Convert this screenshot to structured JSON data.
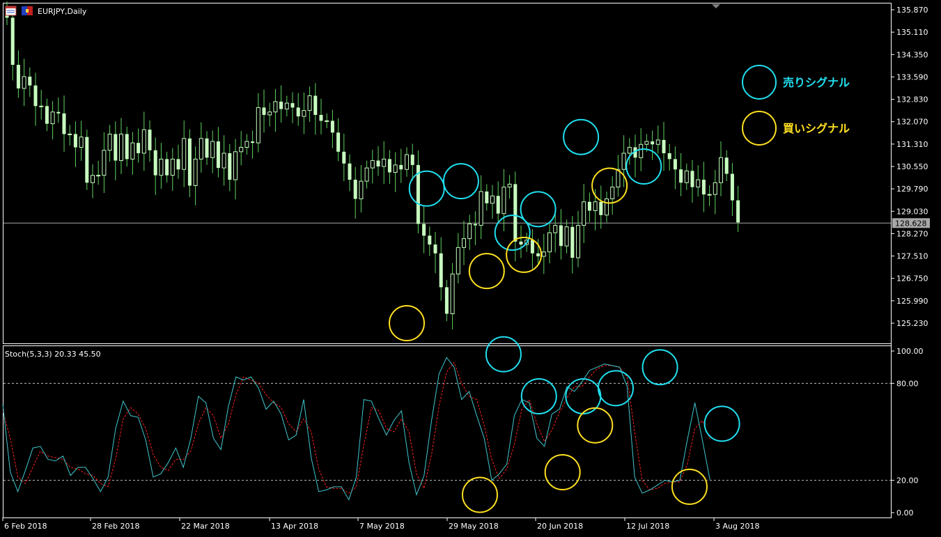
{
  "window": {
    "title": "EURJPY,Daily",
    "icons": [
      "window-menu-icon",
      "flag-icon"
    ]
  },
  "colors": {
    "background": "#000000",
    "axis": "#ffffff",
    "bull_candle": "#c8ffc0",
    "bear_candle": "#c8ffc0",
    "wick": "#5fd35f",
    "price_line": "#a8a8a8",
    "price_tag_bg": "#a8a8a8",
    "stoch_main": "#40c8d0",
    "stoch_signal": "#ff2020",
    "level_line": "#c0c0c0",
    "sell_circle": "#20e0f0",
    "buy_circle": "#ffe020"
  },
  "legend": {
    "sell_label": "売りシグナル",
    "buy_label": "買いシグナル"
  },
  "indicator": {
    "label": "Stoch(5,3,3) 20.33 45.50"
  },
  "current_price": "128.628",
  "chart_data": [
    {
      "type": "candlestick",
      "title": "EURJPY,Daily",
      "ylim": [
        124.6,
        136.05
      ],
      "y_ticks": [
        "135.870",
        "135.110",
        "134.350",
        "133.590",
        "132.830",
        "132.070",
        "131.310",
        "130.550",
        "129.790",
        "129.030",
        "128.270",
        "127.510",
        "126.750",
        "125.990",
        "125.230"
      ],
      "x_ticks": [
        "6 Feb 2018",
        "28 Feb 2018",
        "22 Mar 2018",
        "13 Apr 2018",
        "7 May 2018",
        "29 May 2018",
        "20 Jun 2018",
        "12 Jul 2018",
        "3 Aug 2018"
      ],
      "close": [
        135.6,
        134.0,
        133.2,
        133.6,
        133.3,
        132.6,
        132.6,
        132.0,
        132.4,
        132.35,
        131.65,
        131.65,
        131.2,
        131.55,
        130.0,
        130.25,
        130.25,
        131.1,
        131.65,
        130.75,
        131.65,
        130.8,
        131.35,
        131.0,
        131.8,
        131.1,
        130.25,
        130.8,
        130.25,
        130.8,
        130.45,
        131.5,
        129.9,
        130.8,
        131.5,
        130.85,
        131.4,
        130.5,
        131.0,
        130.1,
        131.05,
        131.2,
        131.4,
        131.35,
        132.55,
        132.3,
        132.4,
        132.75,
        132.5,
        132.7,
        132.55,
        132.25,
        132.45,
        132.95,
        132.3,
        132.1,
        132.1,
        131.7,
        131.05,
        130.65,
        130.1,
        129.45,
        130.05,
        130.5,
        130.75,
        130.55,
        130.8,
        130.35,
        130.6,
        130.45,
        130.95,
        130.6,
        128.6,
        128.2,
        127.9,
        127.6,
        126.45,
        125.55,
        126.9,
        127.8,
        128.1,
        128.6,
        128.55,
        129.7,
        129.3,
        129.55,
        128.95,
        129.85,
        129.95,
        128.0,
        127.9,
        128.05,
        127.6,
        127.5,
        127.65,
        128.3,
        128.55,
        127.85,
        128.5,
        127.45,
        128.55,
        129.35,
        129.05,
        129.35,
        128.9,
        129.45,
        129.85,
        130.45,
        131.0,
        131.2,
        130.85,
        131.3,
        131.4,
        131.3,
        131.45,
        131.0,
        130.8,
        130.45,
        130.0,
        130.4,
        129.85,
        130.1,
        129.6,
        129.6,
        130.0,
        130.85,
        130.3,
        129.4,
        128.65
      ]
    },
    {
      "type": "line",
      "title": "Stoch(5,3,3) 20.33 45.50",
      "ylim": [
        0,
        100
      ],
      "y_ticks": [
        "100.00",
        "80.00",
        "20.00",
        "0.00"
      ],
      "levels": [
        80,
        20
      ],
      "series": [
        {
          "values": [
            67.0,
            25.0,
            13.0,
            26.0,
            40.0,
            41.0,
            33.0,
            32.0,
            35.0,
            23.0,
            28.0,
            28.0,
            21.0,
            13.0,
            22.0,
            52.0,
            69.0,
            60.0,
            59.0,
            45.0,
            22.0,
            24.0,
            31.0,
            40.0,
            28.0,
            46.0,
            72.0,
            68.0,
            46.0,
            39.0,
            66.0,
            84.0,
            82.0,
            84.0,
            77.0,
            64.0,
            69.0,
            61.0,
            45.0,
            48.0,
            70.0,
            34.0,
            13.0,
            14.0,
            16.0,
            16.0,
            8.0,
            22.0,
            70.0,
            69.0,
            58.0,
            48.0,
            57.0,
            63.0,
            31.0,
            11.0,
            23.0,
            57.0,
            86.0,
            96.0,
            90.0,
            70.0,
            75.0,
            60.0,
            46.0,
            20.0,
            24.0,
            30.0,
            60.0,
            70.0,
            68.0,
            46.0,
            41.0,
            61.0,
            64.0,
            78.0,
            75.0,
            81.0,
            88.0,
            90.0,
            92.0,
            91.0,
            90.0,
            78.0,
            22.0,
            12.0,
            14.0,
            17.0,
            20.0,
            19.0,
            20.0,
            45.0,
            68.0,
            45.0,
            20.33
          ]
        },
        {
          "values": [
            63.0,
            46.0,
            22.0,
            18.0,
            28.0,
            38.0,
            35.0,
            34.0,
            33.0,
            28.0,
            27.0,
            24.0,
            23.0,
            18.0,
            16.0,
            33.0,
            58.0,
            65.0,
            61.0,
            52.0,
            36.0,
            28.0,
            26.0,
            33.0,
            33.0,
            38.0,
            55.0,
            65.0,
            60.0,
            46.0,
            55.0,
            73.0,
            84.0,
            82.0,
            80.0,
            73.0,
            68.0,
            65.0,
            55.0,
            50.0,
            58.0,
            50.0,
            27.0,
            16.0,
            15.0,
            15.0,
            12.0,
            16.0,
            42.0,
            65.0,
            63.0,
            52.0,
            50.0,
            58.0,
            50.0,
            24.0,
            15.0,
            36.0,
            66.0,
            87.0,
            93.0,
            80.0,
            72.0,
            70.0,
            54.0,
            33.0,
            21.0,
            27.0,
            42.0,
            64.0,
            70.0,
            55.0,
            44.0,
            51.0,
            62.0,
            71.0,
            78.0,
            78.0,
            84.0,
            89.0,
            91.0,
            91.0,
            90.0,
            84.0,
            50.0,
            20.0,
            14.0,
            15.0,
            18.0,
            19.0,
            19.0,
            30.0,
            52.0,
            57.0,
            45.5
          ]
        }
      ]
    }
  ],
  "signals": {
    "price_sell": [
      [
        73.5,
        129.8
      ],
      [
        79.5,
        130.05
      ],
      [
        88.5,
        128.3
      ],
      [
        93.0,
        129.1
      ],
      [
        100.5,
        131.55
      ],
      [
        111.5,
        130.55
      ]
    ],
    "price_buy": [
      [
        70.0,
        125.23
      ],
      [
        84.0,
        127.0
      ],
      [
        90.5,
        127.55
      ],
      [
        105.5,
        129.9
      ]
    ],
    "stoch_sell": [
      [
        73.0,
        98.0
      ],
      [
        79.0,
        72.0
      ],
      [
        86.5,
        72.0
      ],
      [
        92.0,
        77.0
      ],
      [
        99.5,
        90.0
      ],
      [
        110.0,
        55.0
      ]
    ],
    "stoch_buy": [
      [
        69.0,
        11.0
      ],
      [
        83.0,
        25.0
      ],
      [
        88.5,
        54.0
      ],
      [
        104.5,
        16.0
      ]
    ]
  }
}
